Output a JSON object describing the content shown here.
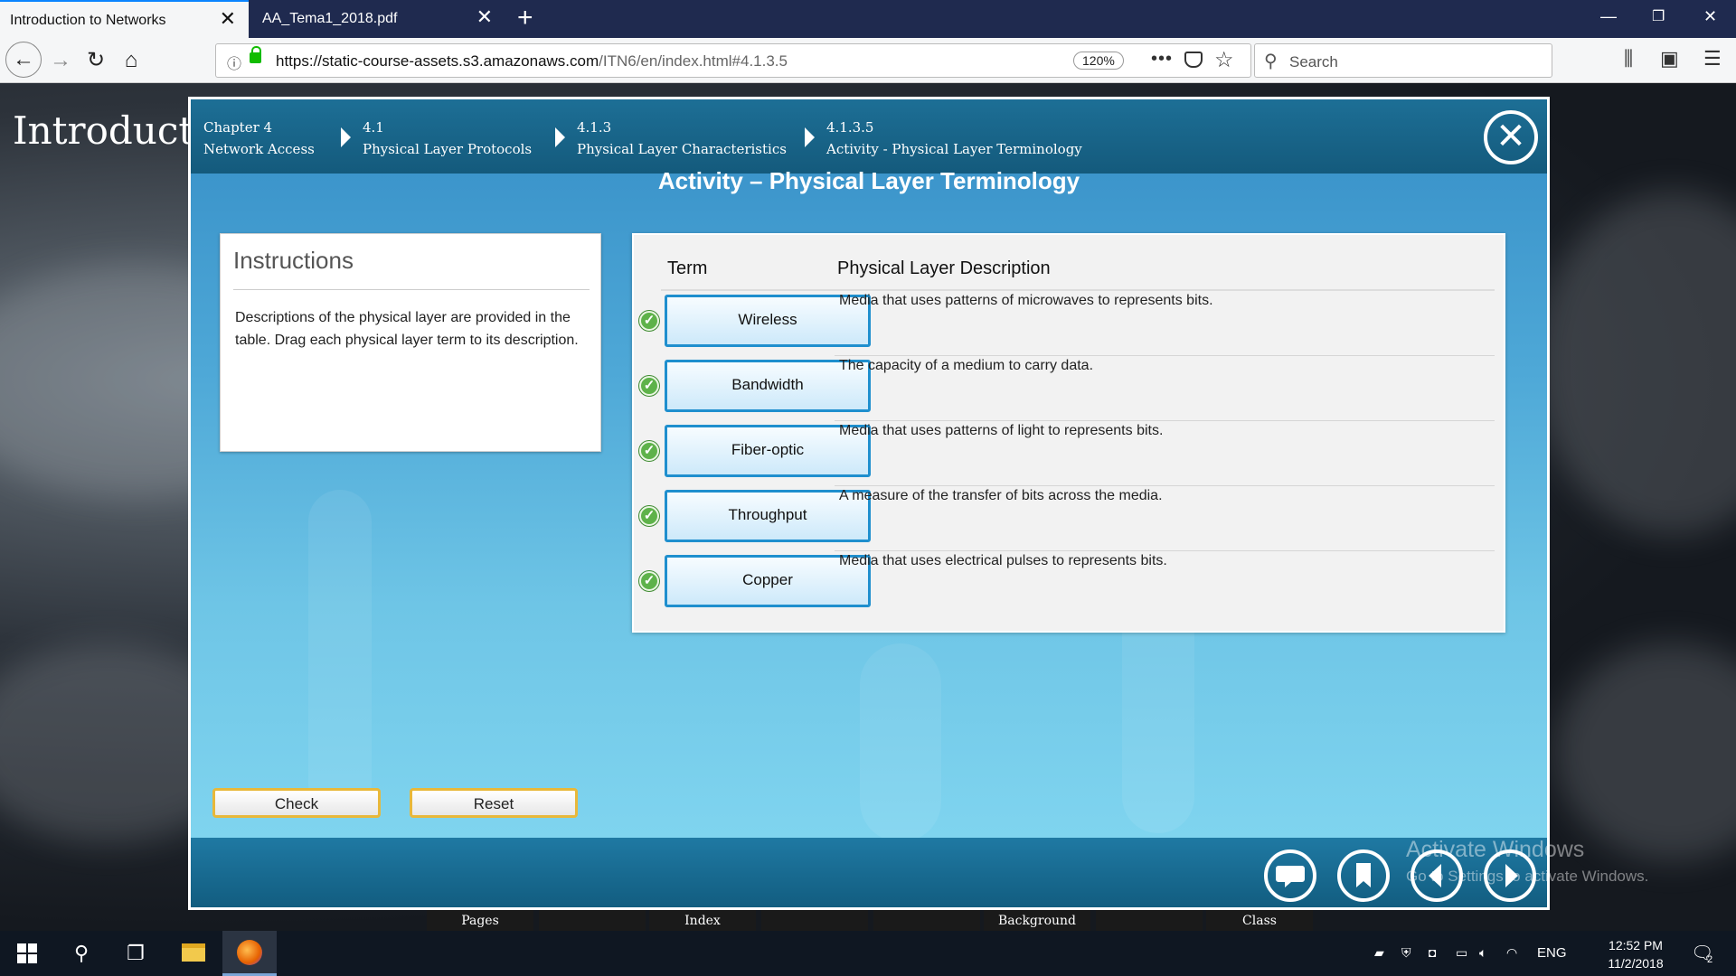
{
  "browser": {
    "tabs": [
      {
        "title": "Introduction to Networks",
        "active": true
      },
      {
        "title": "AA_Tema1_2018.pdf",
        "active": false
      }
    ],
    "url_host": "https://static-course-assets.s3.amazonaws.com",
    "url_path": "/ITN6/en/index.html#4.1.3.5",
    "zoom": "120%",
    "search_placeholder": "Search",
    "more_label": "•••"
  },
  "page": {
    "title": "Introductic",
    "bottom_menu": [
      "Pages",
      "Index",
      "Background",
      "Class"
    ]
  },
  "breadcrumbs": [
    {
      "num": "Chapter 4",
      "label": "Network Access"
    },
    {
      "num": "4.1",
      "label": "Physical Layer Protocols"
    },
    {
      "num": "4.1.3",
      "label": "Physical Layer Characteristics"
    },
    {
      "num": "4.1.3.5",
      "label": "Activity - Physical Layer Terminology"
    }
  ],
  "activity": {
    "title": "Activity – Physical Layer Terminology",
    "instructions_heading": "Instructions",
    "instructions_text": "Descriptions of the physical layer are provided in the table. Drag each physical layer term to its description.",
    "table": {
      "term_header": "Term",
      "desc_header": "Physical Layer Description",
      "rows": [
        {
          "term": "Wireless",
          "description": "Media that uses patterns of microwaves to represents bits.",
          "correct": true
        },
        {
          "term": "Bandwidth",
          "description": "The capacity of a medium to carry data.",
          "correct": true
        },
        {
          "term": "Fiber-optic",
          "description": "Media that uses patterns of light to represents bits.",
          "correct": true
        },
        {
          "term": "Throughput",
          "description": "A measure of the transfer of bits across the media.",
          "correct": true
        },
        {
          "term": "Copper",
          "description": "Media that uses electrical pulses to represents bits.",
          "correct": true
        }
      ]
    },
    "check_label": "Check",
    "reset_label": "Reset"
  },
  "watermark": {
    "line1": "Activate Windows",
    "line2": "Go to Settings to activate Windows."
  },
  "taskbar": {
    "language": "ENG",
    "time": "12:52 PM",
    "date": "11/2/2018",
    "notification_count": "2"
  },
  "colors": {
    "tabstrip": "#1f2a4f",
    "frame_header": "#1d6f96",
    "term_border": "#1f8fce",
    "check_green": "#5eb24a",
    "button_border": "#e8b83a"
  }
}
